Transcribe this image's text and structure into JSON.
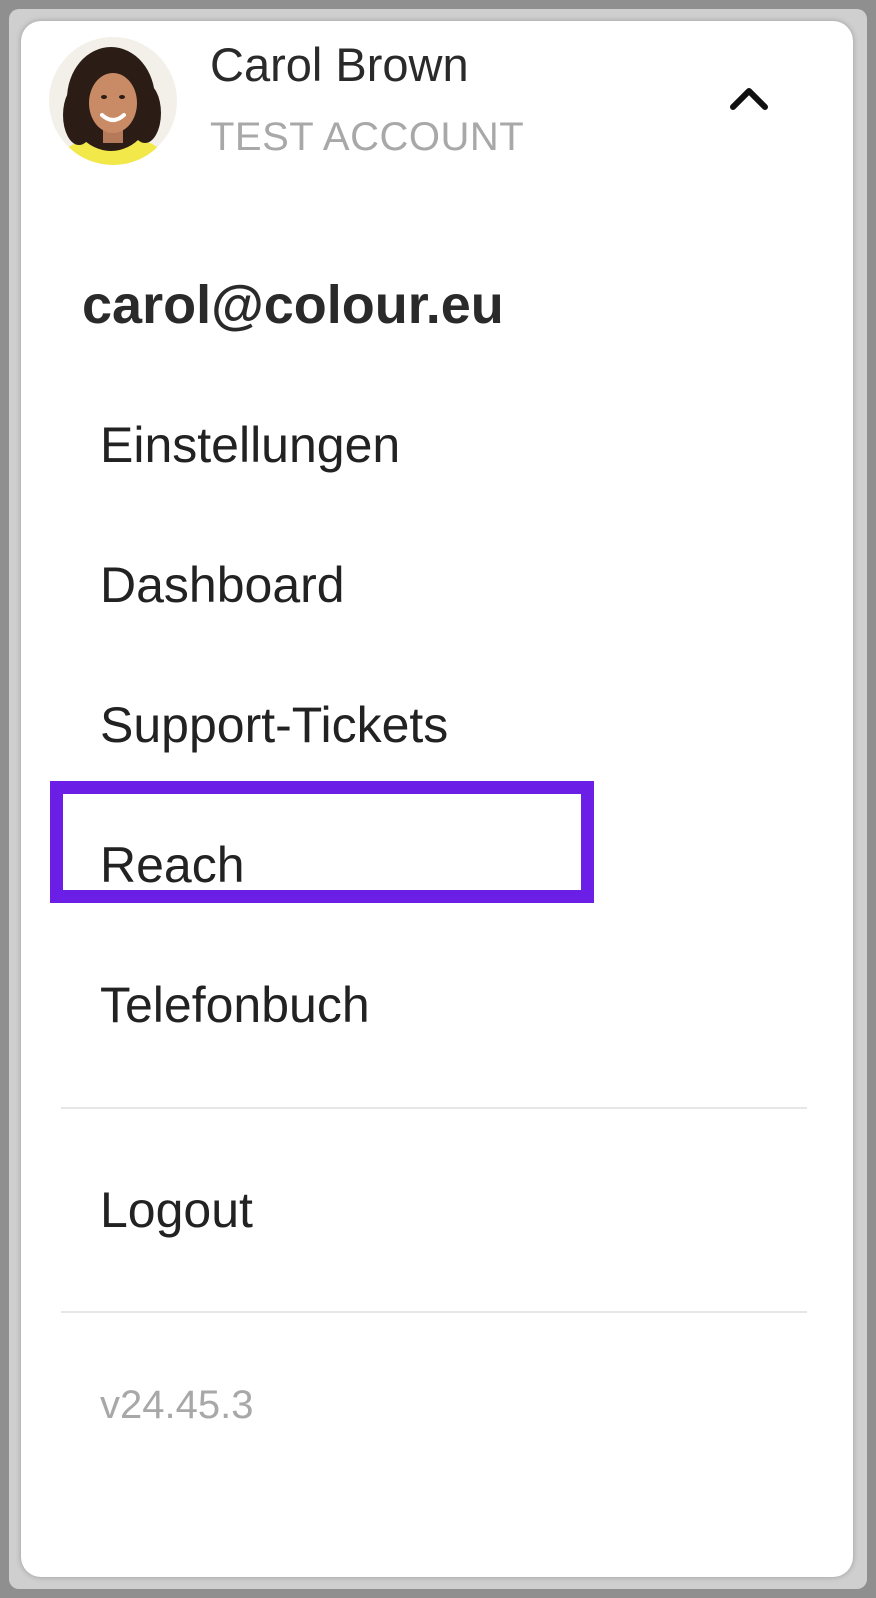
{
  "user": {
    "name": "Carol Brown",
    "role": "TEST ACCOUNT",
    "email": "carol@colour.eu"
  },
  "menu": {
    "items": [
      {
        "label": "Einstellungen"
      },
      {
        "label": "Dashboard"
      },
      {
        "label": "Support-Tickets"
      },
      {
        "label": "Reach",
        "highlighted": true
      },
      {
        "label": "Telefonbuch"
      }
    ],
    "logout_label": "Logout"
  },
  "version": "v24.45.3",
  "icons": {
    "toggle": "chevron-up-icon",
    "avatar": "user-avatar"
  },
  "colors": {
    "highlight": "#6a1ee6",
    "avatar_ring": "#f2e84a",
    "text_primary": "#222222",
    "text_muted": "#a8a8a8"
  }
}
